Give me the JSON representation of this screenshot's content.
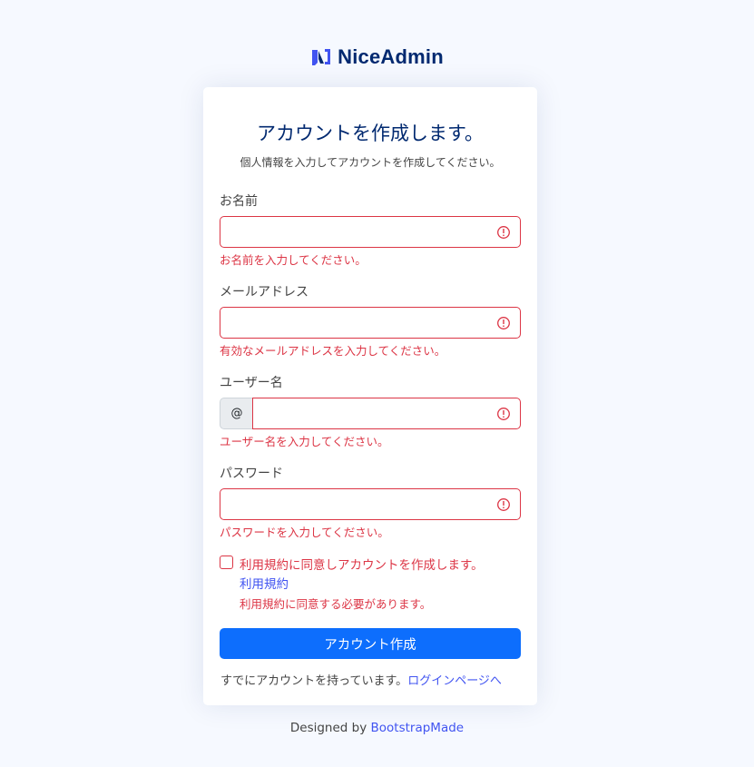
{
  "logo": {
    "text": "NiceAdmin",
    "icon": "nice-admin-logo-icon",
    "color": "#012970",
    "accent": "#4154f1"
  },
  "card": {
    "title": "アカウントを作成します。",
    "subtitle": "個人情報を入力してアカウントを作成してください。"
  },
  "fields": {
    "name": {
      "label": "お名前",
      "value": "",
      "error": "お名前を入力してください。"
    },
    "email": {
      "label": "メールアドレス",
      "value": "",
      "error": "有効なメールアドレスを入力してください。"
    },
    "username": {
      "label": "ユーザー名",
      "prefix": "@",
      "value": "",
      "error": "ユーザー名を入力してください。"
    },
    "password": {
      "label": "パスワード",
      "value": "",
      "error": "パスワードを入力してください。"
    }
  },
  "terms": {
    "label": "利用規約に同意しアカウントを作成します。",
    "link": "利用規約",
    "error": "利用規約に同意する必要があります。",
    "checked": false
  },
  "submit_label": "アカウント作成",
  "login": {
    "text": "すでにアカウントを持っています。",
    "link": "ログインページへ"
  },
  "credits": {
    "text": "Designed by ",
    "link": "BootstrapMade"
  },
  "colors": {
    "background": "#f6f9ff",
    "error": "#dc3545",
    "primary": "#0d6efd",
    "link": "#4154f1"
  }
}
